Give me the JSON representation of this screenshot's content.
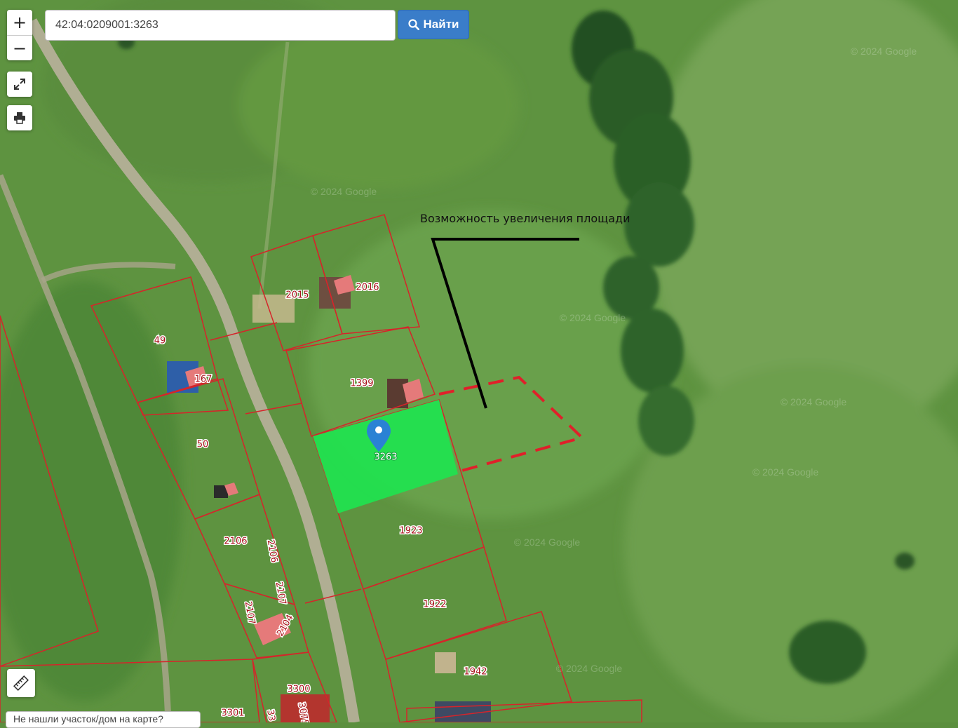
{
  "toolbar": {
    "zoom_in": "+",
    "zoom_out": "−",
    "zoom_in_icon": "plus-icon",
    "zoom_out_icon": "minus-icon",
    "fullscreen_icon": "expand-icon",
    "print_icon": "printer-icon",
    "ruler_icon": "ruler-icon"
  },
  "search": {
    "value": "42:04:0209001:3263",
    "button_label": "Найти",
    "button_icon": "search-icon"
  },
  "annotation": {
    "text": "Возможность увеличения площади"
  },
  "parcels": {
    "selected_label": "3263",
    "labels": [
      "2015",
      "2016",
      "49",
      "167",
      "1399",
      "50",
      "1923",
      "2106",
      "2106",
      "2107",
      "2107",
      "2104",
      "1922",
      "1942",
      "3300",
      "3301",
      "33",
      "3075"
    ]
  },
  "watermarks": [
    "© 2024 Google",
    "© 2024 Google",
    "© 2024 Google",
    "© 2024 Google",
    "© 2024 Google",
    "© 2024 Google",
    "© 2024 Google"
  ],
  "bottom_hint": "Не нашли участок/дом на карте?",
  "colors": {
    "parcel_border": "#d6242a",
    "selected_fill": "#1fe34f",
    "marker": "#2a82d4",
    "button": "#3a7dc9",
    "annotation_line": "#000000",
    "dashed_extension": "#e0202a"
  }
}
